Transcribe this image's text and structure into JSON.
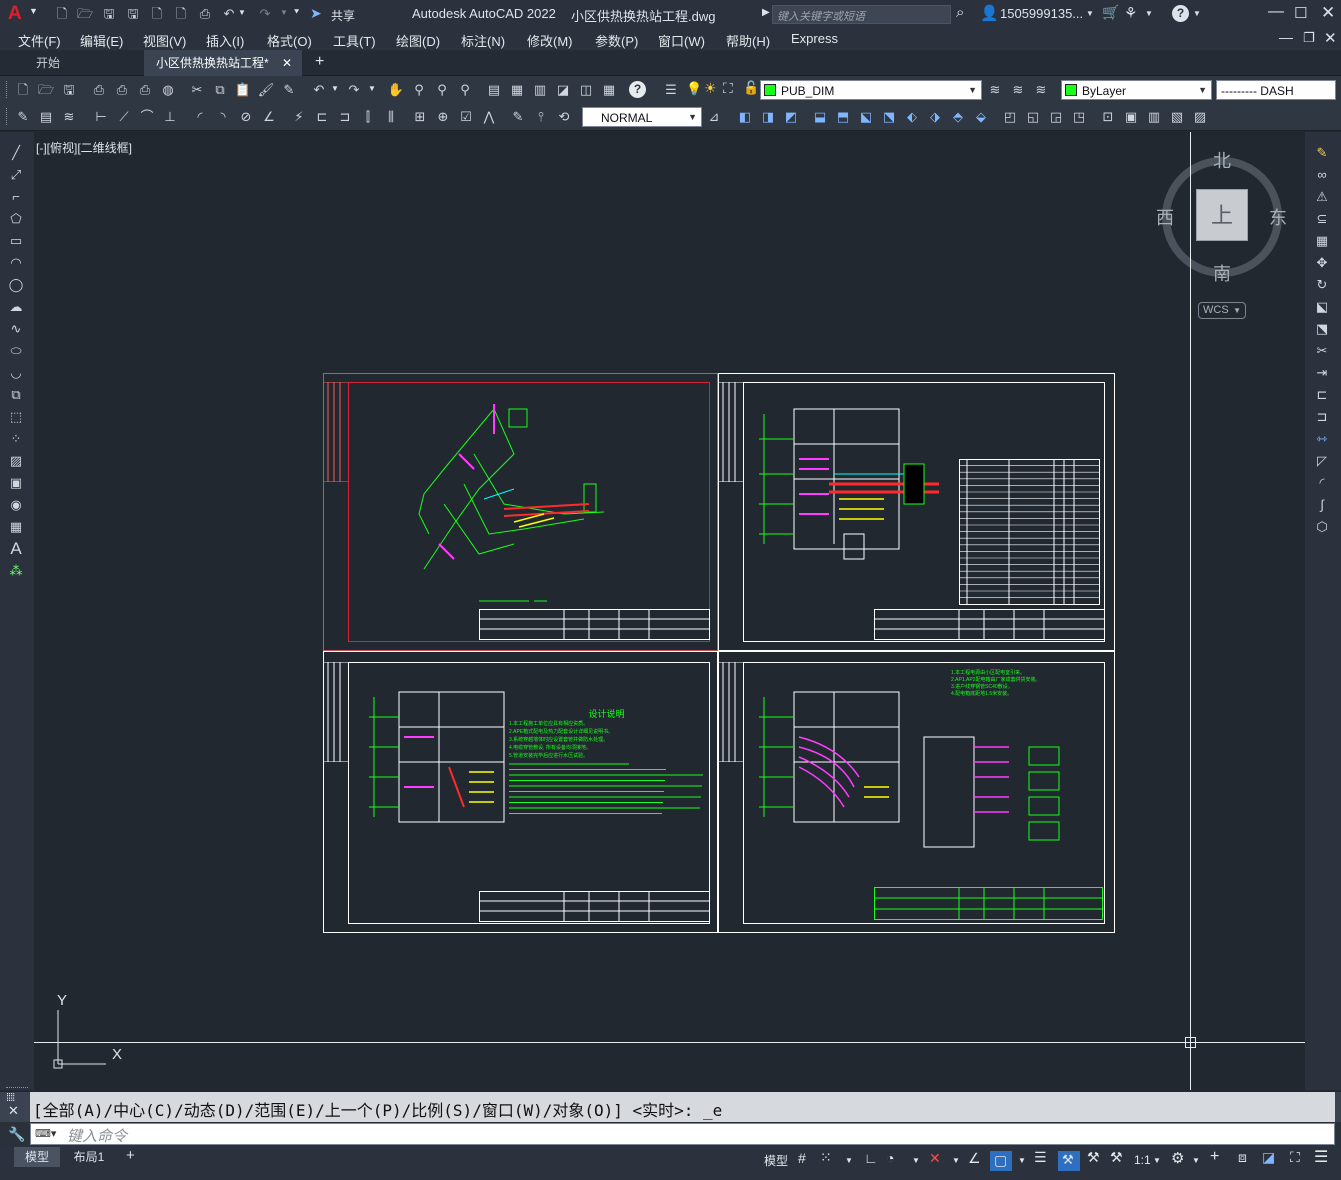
{
  "titlebar": {
    "app_logo": "A",
    "share_label": "共享",
    "app_title": "Autodesk AutoCAD 2022",
    "file_title": "小区供热换热站工程.dwg",
    "search_placeholder": "键入关键字或短语",
    "user_name": "1505999135...",
    "help_icon": "?"
  },
  "menubar": {
    "items": [
      "文件(F)",
      "编辑(E)",
      "视图(V)",
      "插入(I)",
      "格式(O)",
      "工具(T)",
      "绘图(D)",
      "标注(N)",
      "修改(M)",
      "参数(P)",
      "窗口(W)",
      "帮助(H)",
      "Express"
    ]
  },
  "tabs": {
    "start": "开始",
    "drawing": "小区供热换热站工程*",
    "add": "+"
  },
  "toolbar1": {
    "layer_name": "PUB_DIM",
    "color_value": "ByLayer",
    "linetype_value": "--------- DASH"
  },
  "toolbar2": {
    "text_style": "NORMAL"
  },
  "viewport": {
    "label": "[-][俯视][二维线框]",
    "viewcube": {
      "north": "北",
      "south": "南",
      "east": "东",
      "west": "西",
      "top": "上",
      "wcs": "WCS"
    },
    "ucs": {
      "y": "Y",
      "x": "X"
    }
  },
  "drawing_text": {
    "design_notes_title": "设计说明",
    "design_notes_lines": [
      "1.本工程施工单位应具有相应资质。",
      "2.APE箱式配电及热力配套设计详细见说明书。",
      "3.系统穿越墙体时应设置套管并做防水处理。",
      "4.电缆穿管敷设, 所有设备均须接地。",
      "5.管道安装完毕后应进行水压试验。"
    ],
    "electrical_notes": [
      "1.本工程电源由小区配电室引来。",
      "2.AP1,AP2配电箱由厂家成套供货安装。",
      "3.进户线穿钢管SC40敷设。",
      "4.配电箱底距地1.5米安装。"
    ]
  },
  "command": {
    "history": "[全部(A)/中心(C)/动态(D)/范围(E)/上一个(P)/比例(S)/窗口(W)/对象(O)] <实时>: _e",
    "placeholder": "键入命令"
  },
  "statusbar": {
    "tab_model": "模型",
    "tab_layout": "布局1",
    "add": "+",
    "model_label": "模型",
    "scale": "1:1"
  },
  "colors": {
    "bg": "#212830",
    "green": "#18ff18",
    "magenta": "#ff3cff",
    "red": "#ff2b2b",
    "yellow": "#ffff00",
    "cyan": "#00ffff"
  }
}
